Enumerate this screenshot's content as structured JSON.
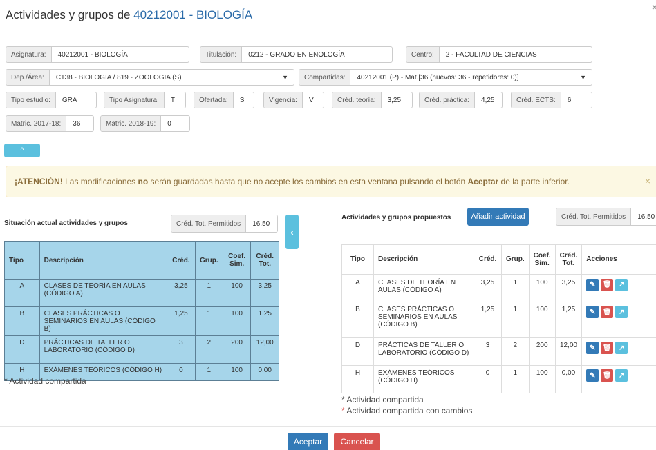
{
  "header": {
    "title_prefix": "Actividades y grupos de ",
    "title_code": "40212001 - BIOLOGÍA",
    "close": "×"
  },
  "info": {
    "asignatura_label": "Asignatura:",
    "asignatura_value": "40212001 - BIOLOGÍA",
    "titulacion_label": "Titulación:",
    "titulacion_value": "0212 - GRADO EN ENOLOGÍA",
    "centro_label": "Centro:",
    "centro_value": "2 - FACULTAD DE CIENCIAS",
    "dep_label": "Dep./Área:",
    "dep_value": "C138 - BIOLOGIA / 819 - ZOOLOGIA (S)",
    "compartidas_label": "Compartidas:",
    "compartidas_value": "40212001 (P) - Mat.[36 (nuevos: 36 - repetidores: 0)]",
    "tipo_estudio_label": "Tipo estudio:",
    "tipo_estudio_value": "GRA",
    "tipo_asig_label": "Tipo Asignatura:",
    "tipo_asig_value": "T",
    "ofertada_label": "Ofertada:",
    "ofertada_value": "S",
    "vigencia_label": "Vigencia:",
    "vigencia_value": "V",
    "cred_teoria_label": "Créd. teoría:",
    "cred_teoria_value": "3,25",
    "cred_practica_label": "Créd. práctica:",
    "cred_practica_value": "4,25",
    "cred_ects_label": "Créd. ECTS:",
    "cred_ects_value": "6",
    "matric1_label": "Matric. 2017-18:",
    "matric1_value": "36",
    "matric2_label": "Matric. 2018-19:",
    "matric2_value": "0",
    "caret": "▼"
  },
  "collapse_icon": "^",
  "alert": {
    "strong1": "¡ATENCIÓN!",
    "text1": " Las modificaciones ",
    "strong2": "no",
    "text2": " serán guardadas hasta que no acepte los cambios en esta ventana pulsando el botón ",
    "strong3": "Aceptar",
    "text3": " de la parte inferior.",
    "close": "×"
  },
  "left": {
    "title": "Situación actual actividades y grupos",
    "cred_label": "Créd. Tot. Permitidos",
    "cred_value": "16,50",
    "headers": [
      "Tipo",
      "Descripción",
      "Créd.",
      "Grup.",
      "Coef. Sim.",
      "Créd. Tot."
    ],
    "rows": [
      [
        "A",
        "CLASES DE TEORÍA EN AULAS (CÓDIGO A)",
        "3,25",
        "1",
        "100",
        "3,25"
      ],
      [
        "B",
        "CLASES PRÁCTICAS O SEMINARIOS EN AULAS (CÓDIGO B)",
        "1,25",
        "1",
        "100",
        "1,25"
      ],
      [
        "D",
        "PRÁCTICAS DE TALLER O LABORATORIO (CÓDIGO D)",
        "3",
        "2",
        "200",
        "12,00"
      ],
      [
        "H",
        "EXÁMENES TEÓRICOS (CÓDIGO H)",
        "0",
        "1",
        "100",
        "0,00"
      ]
    ],
    "note": "* Actividad compartida"
  },
  "side_btn": "‹",
  "right": {
    "title": "Actividades y grupos propuestos",
    "add_label": "Añadir actividad",
    "cred_label": "Créd. Tot. Permitidos",
    "cred_value": "16,50",
    "headers": [
      "Tipo",
      "Descripción",
      "Créd.",
      "Grup.",
      "Coef. Sim.",
      "Créd. Tot.",
      "Acciones"
    ],
    "rows": [
      [
        "A",
        "CLASES DE TEORÍA EN AULAS (CÓDIGO A)",
        "3,25",
        "1",
        "100",
        "3,25"
      ],
      [
        "B",
        "CLASES PRÁCTICAS O SEMINARIOS EN AULAS (CÓDIGO B)",
        "1,25",
        "1",
        "100",
        "1,25"
      ],
      [
        "D",
        "PRÁCTICAS DE TALLER O LABORATORIO (CÓDIGO D)",
        "3",
        "2",
        "200",
        "12,00"
      ],
      [
        "H",
        "EXÁMENES TEÓRICOS (CÓDIGO H)",
        "0",
        "1",
        "100",
        "0,00"
      ]
    ],
    "note1": "* Actividad compartida",
    "note2_star": "*",
    "note2": " Actividad compartida con cambios"
  },
  "icons": {
    "edit": "✎",
    "delete": "🗑",
    "go": "↗"
  },
  "footer": {
    "ok": "Aceptar",
    "cancel": "Cancelar"
  }
}
